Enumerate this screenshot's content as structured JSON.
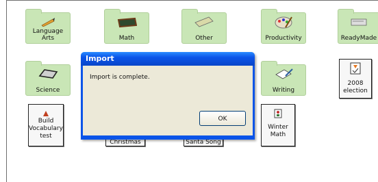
{
  "folders": [
    {
      "label": "Language Arts",
      "icon": "pencil-icon"
    },
    {
      "label": "Math",
      "icon": "chalkboard-icon"
    },
    {
      "label": "Other",
      "icon": "board-icon"
    },
    {
      "label": "Productivity",
      "icon": "palette-icon"
    },
    {
      "label": "ReadyMade",
      "icon": "book-icon"
    },
    {
      "label": "Science",
      "icon": "slate-icon"
    },
    {
      "label": "Writing",
      "icon": "paper-icon"
    }
  ],
  "tiles": [
    {
      "label": "2008 election",
      "icon": "ballot-icon"
    },
    {
      "label": "Build Vocabulary test",
      "icon": "doc-icon"
    },
    {
      "label": "Winter Math",
      "icon": "snow-icon"
    }
  ],
  "label_tiles": [
    {
      "label": "Christmas"
    },
    {
      "label": "Santa Song"
    }
  ],
  "dialog": {
    "title": "Import",
    "message": "Import is complete.",
    "ok_label": "OK"
  },
  "colors": {
    "folder": "#c9e6b6",
    "dialog_title": "#0a54e8",
    "dialog_body": "#ece9d8"
  }
}
